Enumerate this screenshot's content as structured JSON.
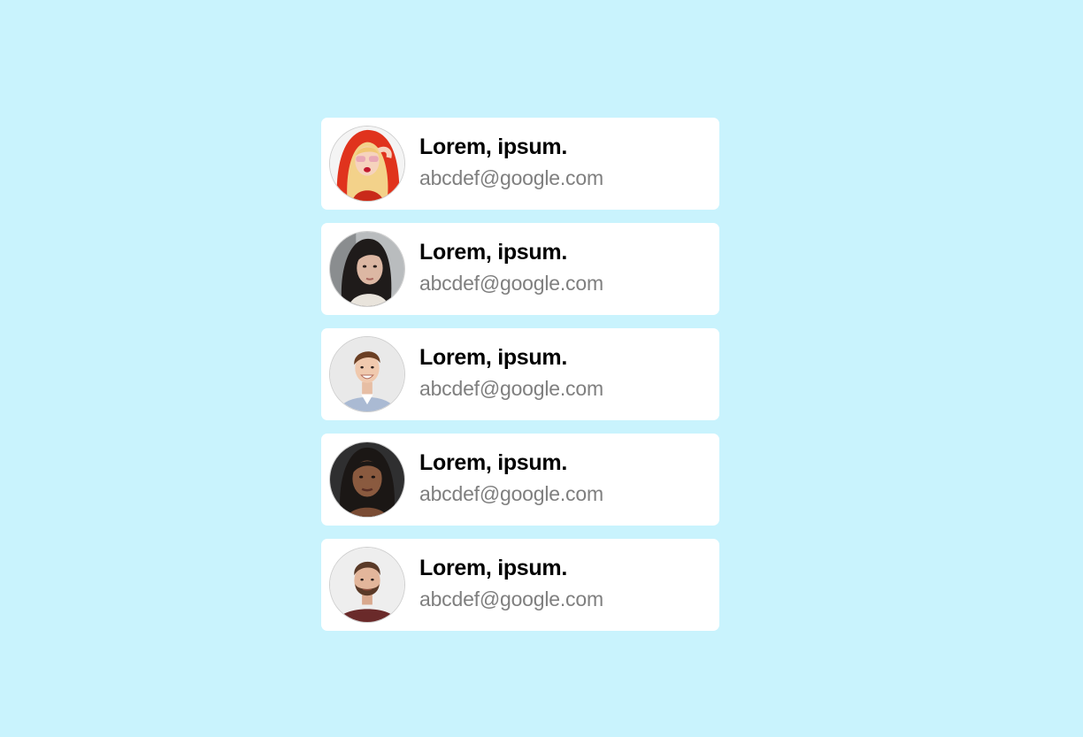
{
  "contacts": [
    {
      "name": "Lorem, ipsum.",
      "email": "abcdef@google.com",
      "avatar": "woman-red-hoodie-avatar"
    },
    {
      "name": "Lorem, ipsum.",
      "email": "abcdef@google.com",
      "avatar": "woman-dark-hair-avatar"
    },
    {
      "name": "Lorem, ipsum.",
      "email": "abcdef@google.com",
      "avatar": "man-smiling-shirt-avatar"
    },
    {
      "name": "Lorem, ipsum.",
      "email": "abcdef@google.com",
      "avatar": "woman-dark-skin-avatar"
    },
    {
      "name": "Lorem, ipsum.",
      "email": "abcdef@google.com",
      "avatar": "man-beard-avatar"
    }
  ],
  "colors": {
    "background": "#c9f3fd",
    "card": "#ffffff",
    "name": "#000000",
    "email": "#7f7f7f"
  }
}
